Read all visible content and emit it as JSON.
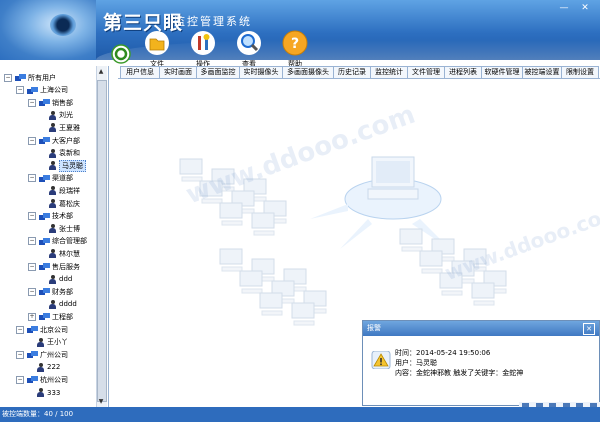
{
  "window": {
    "logo": "第三只眼",
    "subtitle": "监控管理系统",
    "minimize": "—",
    "close": "✕"
  },
  "toolbar": [
    {
      "label": "文件",
      "icon": "folder-icon"
    },
    {
      "label": "操作",
      "icon": "tools-icon"
    },
    {
      "label": "查看",
      "icon": "magnifier-icon"
    },
    {
      "label": "帮助",
      "icon": "help-icon"
    }
  ],
  "tabs": [
    "用户信息",
    "实时画面",
    "多画面监控",
    "实时摄像头",
    "多画面摄像头",
    "历史记录",
    "监控统计",
    "文件管理",
    "进程列表",
    "软硬件管理",
    "被控端设置",
    "限制设置"
  ],
  "tree": [
    {
      "label": "所有用户",
      "kind": "group",
      "level": 0,
      "pm": "−"
    },
    {
      "label": "上海公司",
      "kind": "group",
      "level": 1,
      "pm": "−"
    },
    {
      "label": "销售部",
      "kind": "group",
      "level": 2,
      "pm": "−"
    },
    {
      "label": "刘光",
      "kind": "user",
      "level": 3
    },
    {
      "label": "王夏雅",
      "kind": "user",
      "level": 3
    },
    {
      "label": "大客户部",
      "kind": "group",
      "level": 2,
      "pm": "−"
    },
    {
      "label": "袁新和",
      "kind": "user",
      "level": 3
    },
    {
      "label": "马灵聪",
      "kind": "user",
      "level": 3,
      "selected": true
    },
    {
      "label": "渠道部",
      "kind": "group",
      "level": 2,
      "pm": "−"
    },
    {
      "label": "段瑞祥",
      "kind": "user",
      "level": 3
    },
    {
      "label": "葛松庆",
      "kind": "user",
      "level": 3
    },
    {
      "label": "技术部",
      "kind": "group",
      "level": 2,
      "pm": "−"
    },
    {
      "label": "张士博",
      "kind": "user",
      "level": 3
    },
    {
      "label": "综合管理部",
      "kind": "group",
      "level": 2,
      "pm": "−"
    },
    {
      "label": "林尔慧",
      "kind": "user",
      "level": 3
    },
    {
      "label": "售后服务",
      "kind": "group",
      "level": 2,
      "pm": "−"
    },
    {
      "label": "ddd",
      "kind": "user",
      "level": 3
    },
    {
      "label": "财务部",
      "kind": "group",
      "level": 2,
      "pm": "−"
    },
    {
      "label": "dddd",
      "kind": "user",
      "level": 3
    },
    {
      "label": "工程部",
      "kind": "group",
      "level": 2,
      "pm": "+"
    },
    {
      "label": "北京公司",
      "kind": "group",
      "level": 1,
      "pm": "−"
    },
    {
      "label": "王小丫",
      "kind": "user",
      "level": 2
    },
    {
      "label": "广州公司",
      "kind": "group",
      "level": 1,
      "pm": "−"
    },
    {
      "label": "222",
      "kind": "user",
      "level": 2
    },
    {
      "label": "杭州公司",
      "kind": "group",
      "level": 1,
      "pm": "−"
    },
    {
      "label": "333",
      "kind": "user",
      "level": 2
    }
  ],
  "alarm": {
    "title": "报警",
    "time": "时间：2014-05-24 19:50:06",
    "user": "用户：马灵聪",
    "content": "内容：金蛇神邪教 触发了关键字：金蛇神"
  },
  "status": {
    "text": "被控端数量：40 / 100"
  },
  "watermark": "www.ddooo.com"
}
